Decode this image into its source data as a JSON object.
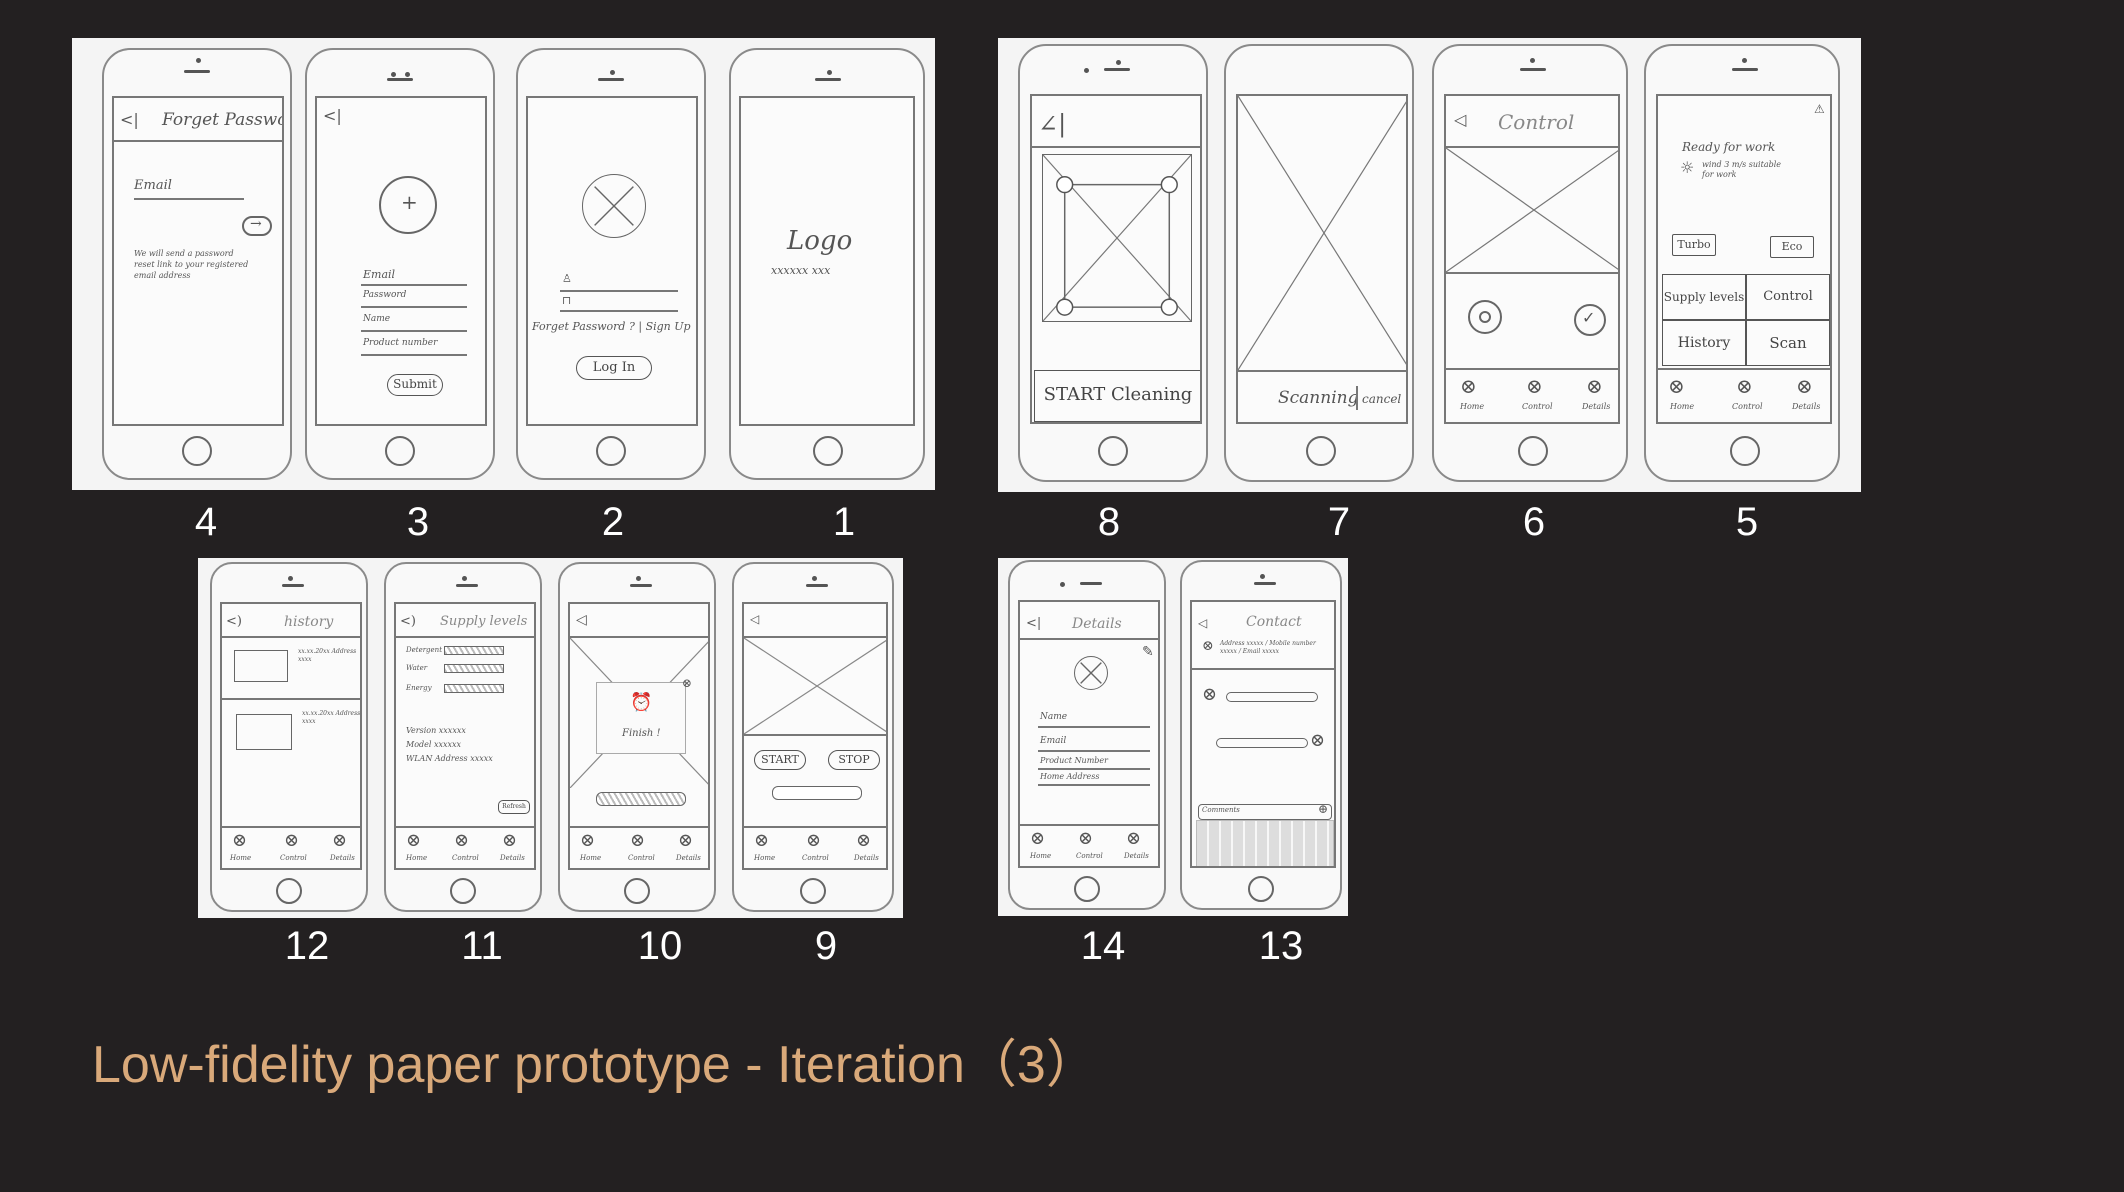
{
  "caption": "Low-fidelity paper prototype - Iteration（3）",
  "labels": {
    "row1_left": [
      "4",
      "3",
      "2",
      "1"
    ],
    "row1_right": [
      "8",
      "7",
      "6",
      "5"
    ],
    "row2_left": [
      "12",
      "11",
      "10",
      "9"
    ],
    "row2_right": [
      "14",
      "13"
    ]
  },
  "screens": {
    "s4": {
      "title": "Forget Password",
      "email": "Email",
      "note": "We will send a password reset link to your registered email address"
    },
    "s3": {
      "fields": [
        "Email",
        "Password",
        "Name",
        "Product number"
      ],
      "submit": "Submit"
    },
    "s2": {
      "links": "Forget Password ? | Sign Up",
      "login": "Log In"
    },
    "s1": {
      "logo": "Logo",
      "tagline": "xxxxxx xxx"
    },
    "s8": {
      "button": "START Cleaning"
    },
    "s7": {
      "scanning": "Scanning",
      "cancel": "cancel"
    },
    "s6": {
      "title": "Control",
      "tabs": [
        "Home",
        "Control",
        "Details"
      ]
    },
    "s5": {
      "status": "Ready for work",
      "weather": "wind 3 m/s suitable for work",
      "modes": [
        "Turbo",
        "Eco"
      ],
      "grid": [
        "Supply levels",
        "Control",
        "History",
        "Scan"
      ],
      "tabs": [
        "Home",
        "Control",
        "Details"
      ]
    },
    "s12": {
      "title": "history",
      "items": [
        "xx.xx.20xx Address xxxx",
        "xx.xx.20xx Address xxxx"
      ],
      "tabs": [
        "Home",
        "Control",
        "Details"
      ]
    },
    "s11": {
      "title": "Supply levels",
      "levels": [
        "Detergent",
        "Water",
        "Energy"
      ],
      "info": [
        "Version  xxxxxx",
        "Model  xxxxxx",
        "WLAN Address xxxxx"
      ],
      "refresh": "Refresh",
      "tabs": [
        "Home",
        "Control",
        "Details"
      ]
    },
    "s10": {
      "finish": "Finish !",
      "tabs": [
        "Home",
        "Control",
        "Details"
      ]
    },
    "s9": {
      "start": "START",
      "stop": "STOP",
      "tabs": [
        "Home",
        "Control",
        "Details"
      ]
    },
    "s14": {
      "title": "Details",
      "fields": [
        "Name",
        "Email",
        "Product Number",
        "Home Address"
      ],
      "tabs": [
        "Home",
        "Control",
        "Details"
      ]
    },
    "s13": {
      "title": "Contact",
      "info": "Address xxxxx / Mobile number xxxxx / Email xxxxx",
      "input": "Comments"
    }
  }
}
